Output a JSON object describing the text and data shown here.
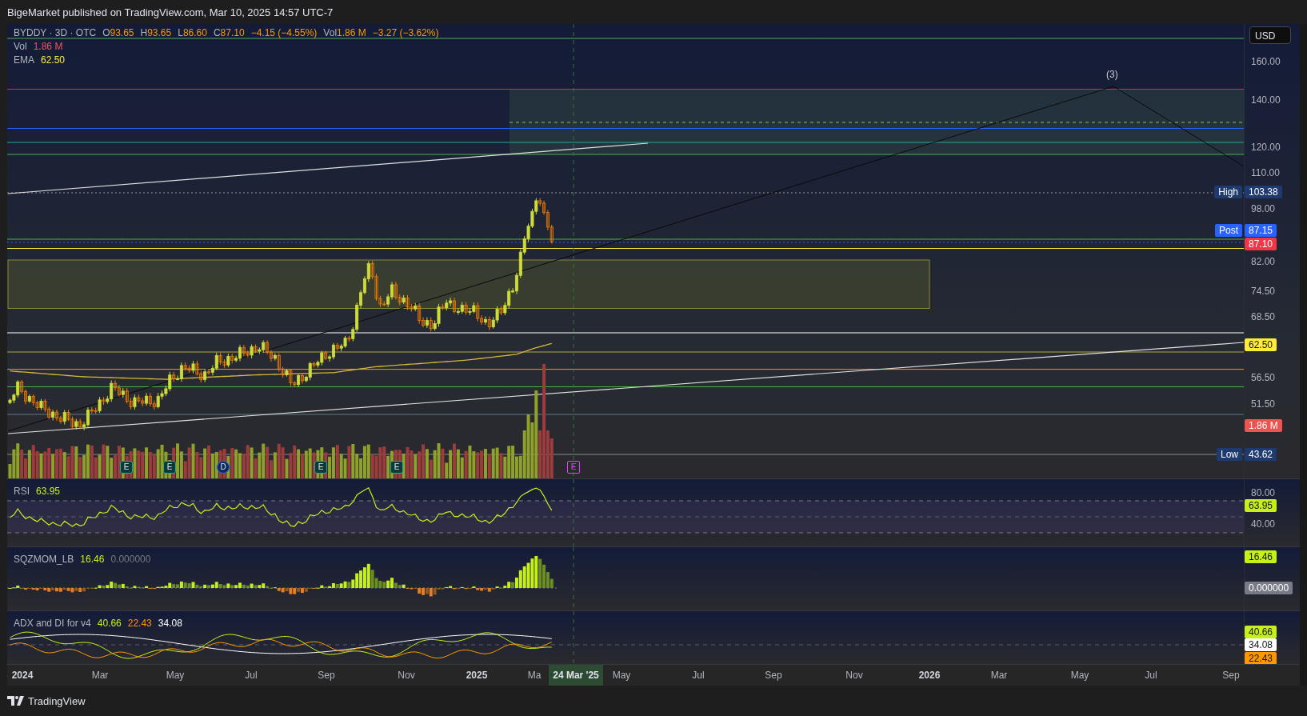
{
  "header": {
    "text": "BigeMarket published on TradingView.com, Mar 10, 2025 14:57 UTC-7"
  },
  "main_pane": {
    "legend": {
      "symbol": "BYDDY · 3D · OTC",
      "ohlc": [
        {
          "key": "O",
          "value": "93.65"
        },
        {
          "key": "H",
          "value": "93.65"
        },
        {
          "key": "L",
          "value": "86.60"
        },
        {
          "key": "C",
          "value": "87.10"
        }
      ],
      "change": "−4.15 (−4.55%)",
      "volume_key": "Vol",
      "volume_value": "1.86 M",
      "volume_change": "−3.27 (−3.62%)",
      "studies": [
        {
          "name": "Vol",
          "value": "1.86 M",
          "color": "#f7525f"
        },
        {
          "name": "EMA",
          "value": "62.50",
          "color": "#ffeb3b"
        }
      ]
    },
    "wave_label": "(3)",
    "markers": [
      {
        "kind": "earnings",
        "letter": "E"
      },
      {
        "kind": "earnings",
        "letter": "E"
      },
      {
        "kind": "dividend",
        "letter": "D"
      },
      {
        "kind": "earnings",
        "letter": "E"
      },
      {
        "kind": "earnings",
        "letter": "E"
      },
      {
        "kind": "upcoming",
        "letter": "E"
      }
    ],
    "price_axis": {
      "currency": "USD",
      "labels": [
        "160.00",
        "140.00",
        "120.00",
        "110.00",
        "98.00",
        "82.00",
        "74.50",
        "68.50",
        "56.50",
        "51.50"
      ],
      "tags": [
        {
          "label": "High",
          "value": "103.38",
          "color": "#1e3a6e"
        },
        {
          "label": "Post",
          "value": "87.15",
          "color": "#2962ff"
        },
        {
          "value": "87.10",
          "color": "#f23645"
        },
        {
          "value": "62.50",
          "color": "#ffeb3b"
        },
        {
          "value": "1.86 M",
          "color": "#ef5350"
        },
        {
          "label": "Low",
          "value": "43.62",
          "color": "#1e3a6e"
        }
      ]
    }
  },
  "indicator_panes": [
    {
      "name": "RSI",
      "values": [
        {
          "text": "63.95",
          "color": "#c6f01a"
        }
      ],
      "axis_labels": [
        "80.00",
        "40.00"
      ],
      "tags": [
        {
          "value": "63.95",
          "color": "#c6f01a"
        }
      ]
    },
    {
      "name": "SQZMOM_LB",
      "values": [
        {
          "text": "16.46",
          "color": "#c6f01a"
        },
        {
          "text": "0.000000",
          "color": "#787b86"
        }
      ],
      "tags": [
        {
          "value": "16.46",
          "color": "#c6f01a"
        },
        {
          "value": "0.000000",
          "color": "#787b86"
        }
      ]
    },
    {
      "name": "ADX and DI for v4",
      "values": [
        {
          "text": "40.66",
          "color": "#c6f01a"
        },
        {
          "text": "22.43",
          "color": "#ff9800"
        },
        {
          "text": "34.08",
          "color": "#ffffff"
        }
      ],
      "tags": [
        {
          "value": "40.66",
          "color": "#c6f01a"
        },
        {
          "value": "34.08",
          "color": "#ffffff"
        },
        {
          "value": "22.43",
          "color": "#ff9800"
        }
      ]
    }
  ],
  "time_axis": {
    "labels": [
      {
        "text": "2024",
        "kind": "year"
      },
      {
        "text": "Mar",
        "kind": "month"
      },
      {
        "text": "May",
        "kind": "month"
      },
      {
        "text": "Jul",
        "kind": "month"
      },
      {
        "text": "Sep",
        "kind": "month"
      },
      {
        "text": "Nov",
        "kind": "month"
      },
      {
        "text": "2025",
        "kind": "year"
      },
      {
        "text": "Ma",
        "kind": "month"
      },
      {
        "text": "May",
        "kind": "month"
      },
      {
        "text": "Jul",
        "kind": "month"
      },
      {
        "text": "Sep",
        "kind": "month"
      },
      {
        "text": "Nov",
        "kind": "month"
      },
      {
        "text": "2026",
        "kind": "year"
      },
      {
        "text": "Mar",
        "kind": "month"
      },
      {
        "text": "May",
        "kind": "month"
      },
      {
        "text": "Jul",
        "kind": "month"
      },
      {
        "text": "Sep",
        "kind": "month"
      }
    ],
    "crosshair_label": "24 Mar '25"
  },
  "footer": {
    "brand": "TradingView"
  }
}
